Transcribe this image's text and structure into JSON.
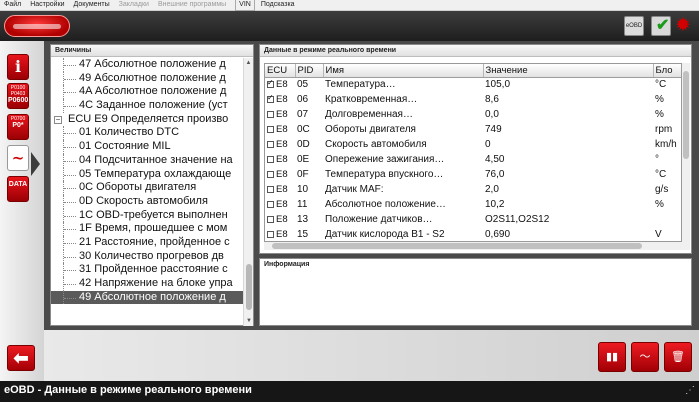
{
  "menu": [
    "Файл",
    "Настройки",
    "Документы",
    "Закладки",
    "Внешние программы",
    "VIN",
    "Подсказка"
  ],
  "menu_disabled": [
    "Закладки",
    "Внешние программы"
  ],
  "header": {
    "eobd_label": "eOBD"
  },
  "sidebar": {
    "info_label": "i",
    "dtc1_codes": [
      "P0100",
      "P0403",
      "P0600"
    ],
    "dtc2_codes": [
      "P0700",
      "P0*"
    ],
    "realtime_label": "~",
    "data_label": "DATA"
  },
  "values_panel": {
    "title": "Величины",
    "items": [
      "47 Абсолютное положение д",
      "49 Абсолютное положение д",
      "4A Абсолютное положение д",
      "4C Заданное положение (уст",
      "ECU E9 Определяется произво",
      "01 Количество DTC",
      "01 Состояние MIL",
      "04 Подсчитанное значение на",
      "05 Температура охлаждающе",
      "0C Обороты двигателя",
      "0D Скорость автомобиля",
      "1C OBD-требуется выполнен",
      "1F Время, прошедшее с мом",
      "21 Расстояние, пройденное с",
      "30 Количество прогревов дв",
      "31 Пройденное расстояние с",
      "42 Напряжение на блоке упра",
      "49 Абсолютное положение д"
    ]
  },
  "realtime_panel": {
    "title": "Данные в режиме реального времени",
    "columns": [
      "ECU",
      "PID",
      "Имя",
      "Значение",
      "Бло"
    ],
    "rows": [
      {
        "checked": true,
        "ecu": "E8",
        "pid": "05",
        "name": "Температура…",
        "value": "105,0",
        "unit": "°C"
      },
      {
        "checked": true,
        "ecu": "E8",
        "pid": "06",
        "name": "Кратковременная…",
        "value": "8,6",
        "unit": "%"
      },
      {
        "checked": false,
        "ecu": "E8",
        "pid": "07",
        "name": "Долговременная…",
        "value": "0,0",
        "unit": "%"
      },
      {
        "checked": false,
        "ecu": "E8",
        "pid": "0C",
        "name": "Обороты двигателя",
        "value": "749",
        "unit": "rpm"
      },
      {
        "checked": false,
        "ecu": "E8",
        "pid": "0D",
        "name": "Скорость автомобиля",
        "value": "0",
        "unit": "km/h"
      },
      {
        "checked": false,
        "ecu": "E8",
        "pid": "0E",
        "name": "Опережение зажигания…",
        "value": "4,50",
        "unit": "°"
      },
      {
        "checked": false,
        "ecu": "E8",
        "pid": "0F",
        "name": "Температура впускного…",
        "value": "76,0",
        "unit": "°C"
      },
      {
        "checked": false,
        "ecu": "E8",
        "pid": "10",
        "name": "Датчик MAF:",
        "value": "2,0",
        "unit": "g/s"
      },
      {
        "checked": false,
        "ecu": "E8",
        "pid": "11",
        "name": "Абсолютное положение…",
        "value": "10,2",
        "unit": "%"
      },
      {
        "checked": false,
        "ecu": "E8",
        "pid": "13",
        "name": "Положение датчиков…",
        "value": "O2S11,O2S12",
        "unit": ""
      },
      {
        "checked": false,
        "ecu": "E8",
        "pid": "15",
        "name": "Датчик кислорода B1 - S2",
        "value": "0,690",
        "unit": "V"
      }
    ]
  },
  "info_panel": {
    "title": "Информация"
  },
  "bottom_buttons": [
    "mg-hr-chart",
    "graph-view",
    "delete"
  ],
  "status": {
    "title": "eOBD - Данные в режиме реального времени"
  }
}
